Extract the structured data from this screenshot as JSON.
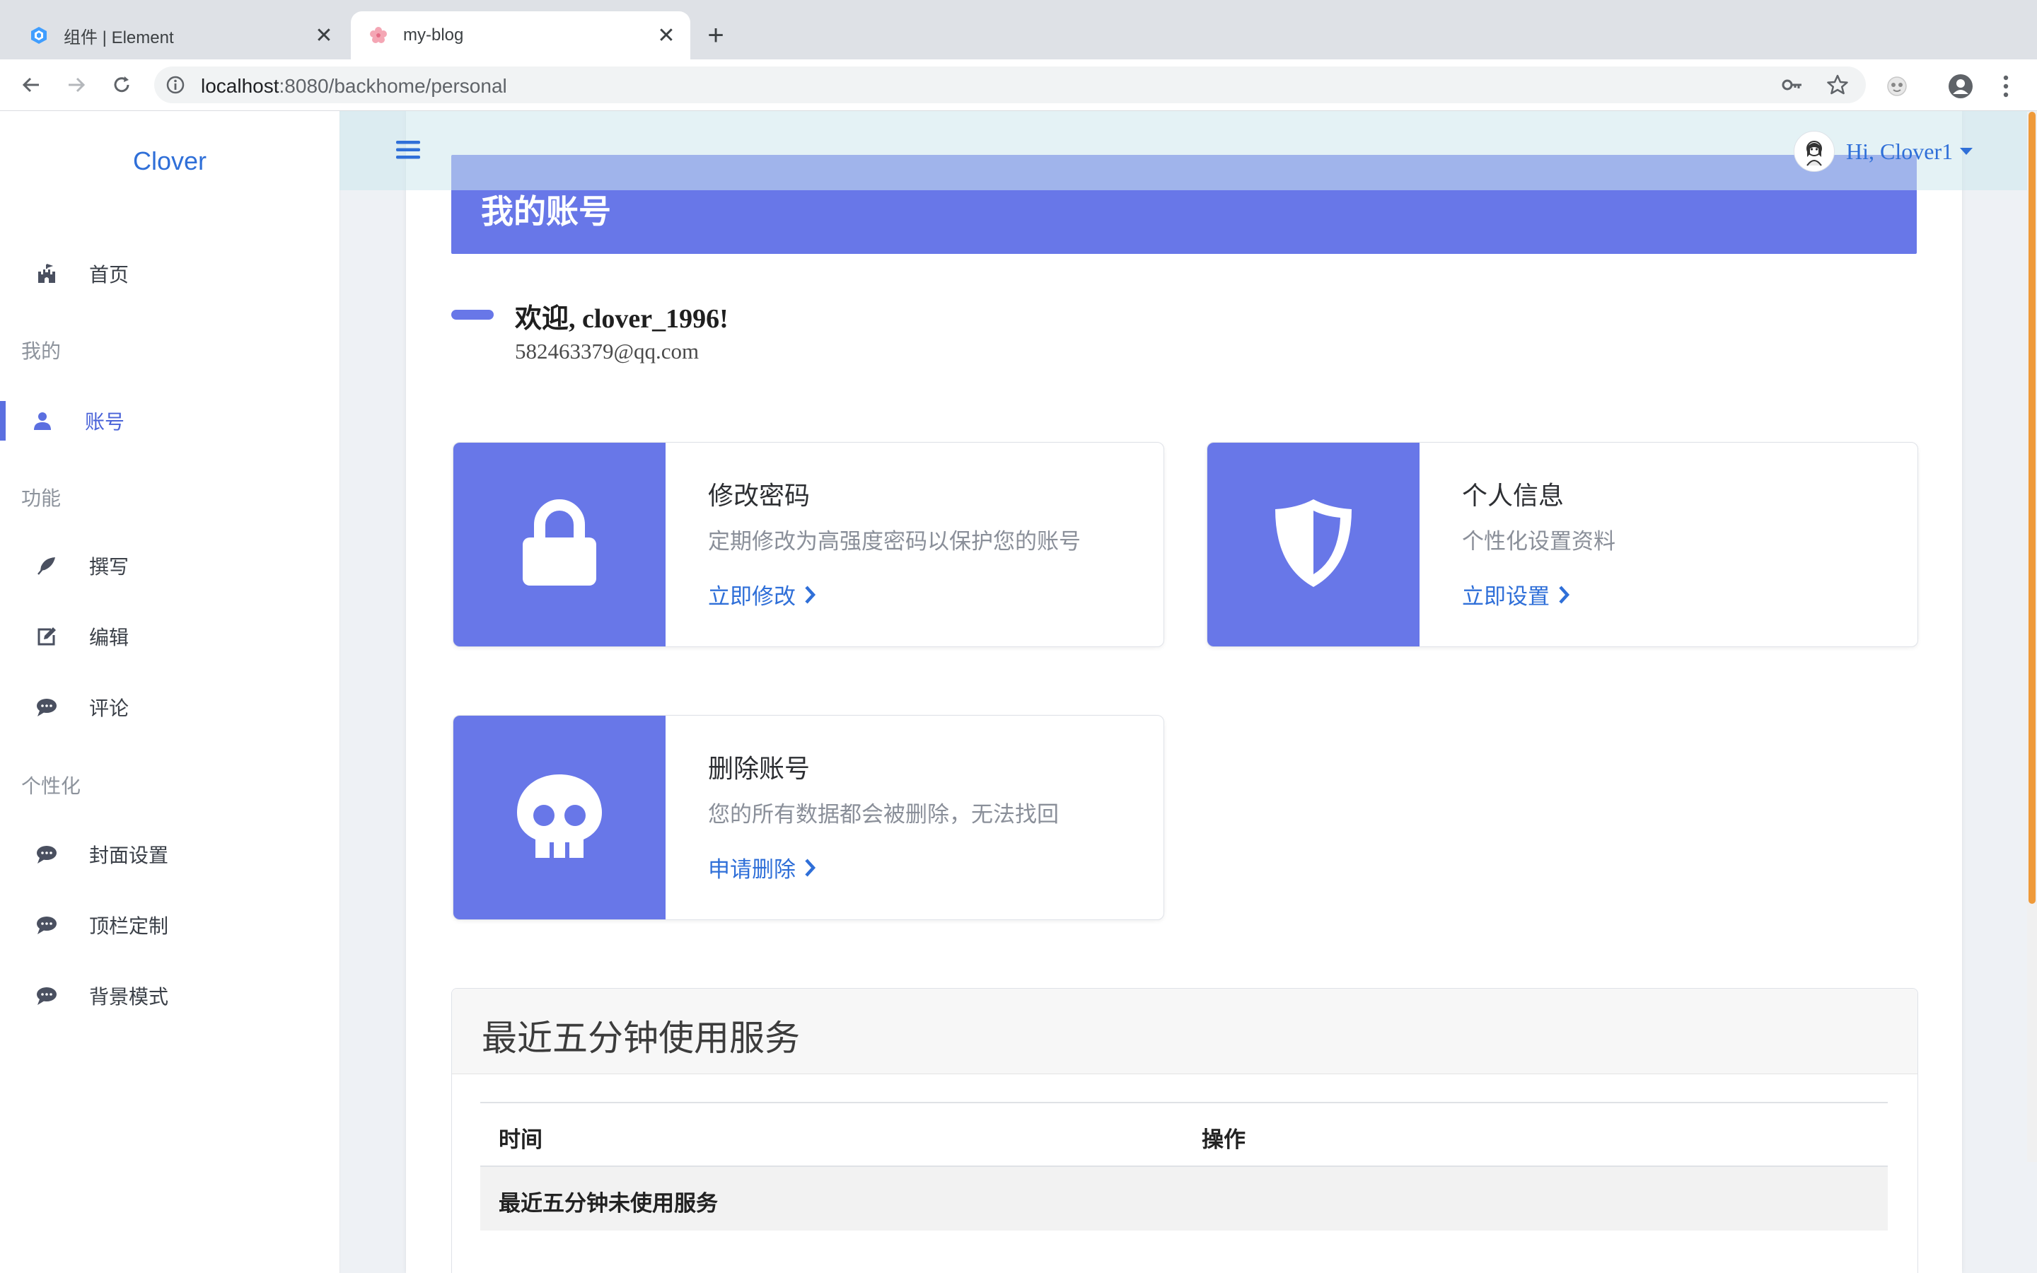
{
  "browser": {
    "tabs": [
      {
        "title": "组件 | Element",
        "favicon": "element-logo-icon"
      },
      {
        "title": "my-blog",
        "favicon": "sakura-icon"
      }
    ],
    "url_host": "localhost",
    "url_rest": ":8080/backhome/personal"
  },
  "sidebar": {
    "brand": "Clover",
    "home": {
      "label": "首页",
      "icon": "castle-icon"
    },
    "sections": [
      {
        "label": "我的"
      },
      {
        "label": "功能"
      },
      {
        "label": "个性化"
      }
    ],
    "items": [
      {
        "label": "账号",
        "icon": "user-icon",
        "active": true
      },
      {
        "label": "撰写",
        "icon": "feather-icon"
      },
      {
        "label": "编辑",
        "icon": "edit-icon"
      },
      {
        "label": "评论",
        "icon": "comment-icon"
      },
      {
        "label": "封面设置",
        "icon": "comment-icon"
      },
      {
        "label": "顶栏定制",
        "icon": "comment-icon"
      },
      {
        "label": "背景模式",
        "icon": "comment-icon"
      }
    ]
  },
  "topbar": {
    "greeting": "Hi, Clover1"
  },
  "main": {
    "header": "我的账号",
    "welcome": "欢迎, clover_1996!",
    "email": "582463379@qq.com",
    "cards": [
      {
        "title": "修改密码",
        "desc": "定期修改为高强度密码以保护您的账号",
        "link": "立即修改",
        "icon": "lock-icon"
      },
      {
        "title": "个人信息",
        "desc": "个性化设置资料",
        "link": "立即设置",
        "icon": "shield-icon"
      },
      {
        "title": "删除账号",
        "desc": "您的所有数据都会被删除，无法找回",
        "link": "申请删除",
        "icon": "skull-icon"
      }
    ],
    "panel": {
      "title": "最近五分钟使用服务",
      "columns": [
        "时间",
        "操作"
      ],
      "empty_text": "最近五分钟未使用服务"
    }
  },
  "colors": {
    "accent": "#6877e8",
    "link": "#2f6fd8",
    "scroll_thumb": "#ef9a3a"
  }
}
